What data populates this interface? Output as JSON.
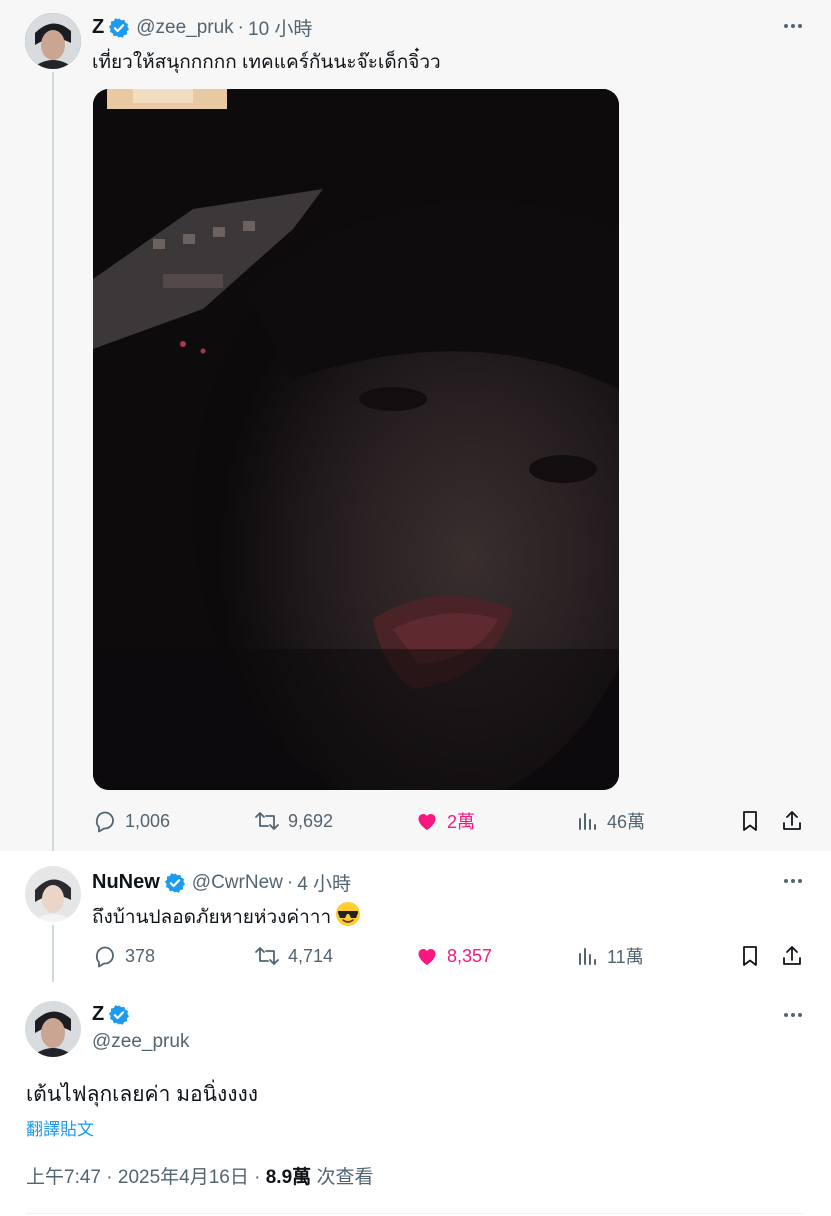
{
  "tweets": [
    {
      "name": "Z",
      "handle": "@zee_pruk",
      "dot": "·",
      "time": "10 小時",
      "text": "เที่ยวให้สนุกกกกก เทคแคร์กันนะจ๊ะเด็กจิ๋วว",
      "stats": {
        "replies": "1,006",
        "retweets": "9,692",
        "likes": "2萬",
        "views": "46萬"
      }
    },
    {
      "name": "NuNew",
      "handle": "@CwrNew",
      "dot": "·",
      "time": "4 小時",
      "text": "ถึงบ้านปลอดภัยหายห่วงค่าาา",
      "stats": {
        "replies": "378",
        "retweets": "4,714",
        "likes": "8,357",
        "views": "11萬"
      }
    }
  ],
  "main_tweet": {
    "name": "Z",
    "handle": "@zee_pruk",
    "text": "เต้นไฟลุกเลยค่า มอนิ่งงงง",
    "translate": "翻譯貼文",
    "time": "上午7:47",
    "date": "2025年4月16日",
    "views": "8.9萬",
    "views_label": "次查看",
    "sep": "·"
  },
  "icons": {
    "reply": "reply-icon",
    "retweet": "retweet-icon",
    "like": "heart-icon",
    "views": "analytics-icon",
    "bookmark": "bookmark-icon",
    "share": "share-icon",
    "more": "more-icon",
    "verified": "verified-badge-icon",
    "emoji": "sunglasses-emoji"
  },
  "colors": {
    "verified": "#1d9bf0",
    "like": "#f91880",
    "secondary": "#536471",
    "link": "#1d9bf0"
  }
}
